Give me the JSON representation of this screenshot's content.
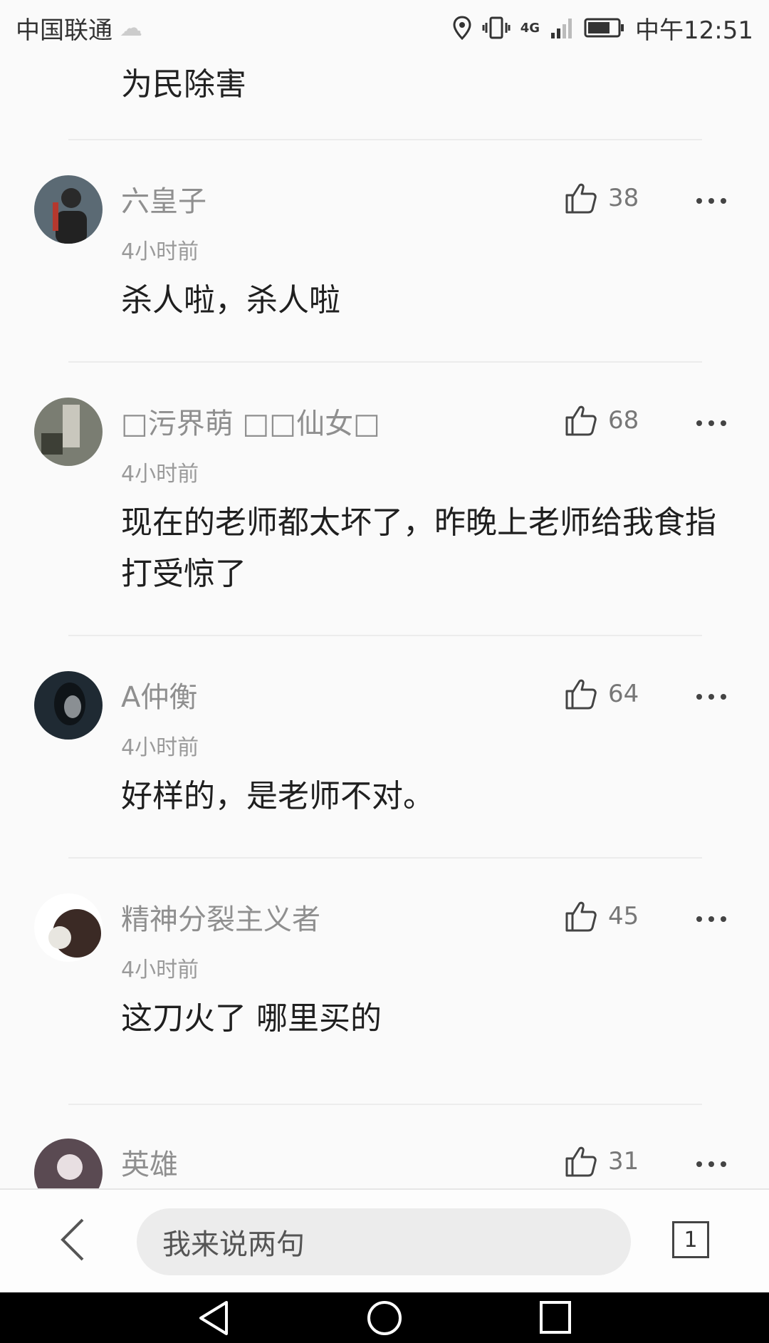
{
  "status_bar": {
    "carrier": "中国联通",
    "network": "4G",
    "time": "中午12:51"
  },
  "top_fragment": "为民除害",
  "comments": [
    {
      "username": "六皇子",
      "time": "4小时前",
      "likes": "38",
      "content": "杀人啦，杀人啦",
      "avatar_color": "#5b6a74"
    },
    {
      "username": "□污界萌 □□仙女□",
      "time": "4小时前",
      "likes": "68",
      "content": "现在的老师都太坏了，昨晚上老师给我食指打受惊了",
      "avatar_color": "#7a7d72"
    },
    {
      "username": "A仲衡",
      "time": "4小时前",
      "likes": "64",
      "content": "好样的，是老师不对。",
      "avatar_color": "#1f2a33"
    },
    {
      "username": "精神分裂主义者",
      "time": "4小时前",
      "likes": "45",
      "content": "这刀火了 哪里买的",
      "avatar_color": "#3b2a25"
    },
    {
      "username": "英雄",
      "likes": "31",
      "avatar_color": "#5a4a52"
    }
  ],
  "bottom_bar": {
    "input_placeholder": "我来说两句",
    "comment_count": "1"
  }
}
